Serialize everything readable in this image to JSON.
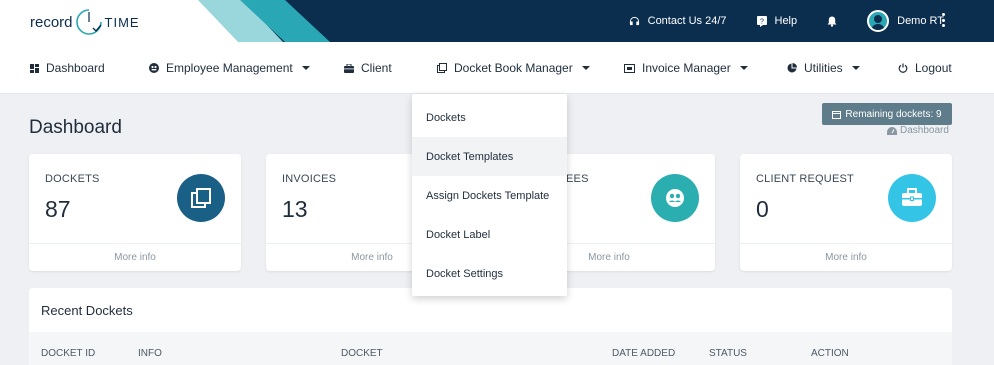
{
  "brand": {
    "logo_word": "record",
    "logo_sub": "TIME"
  },
  "topbar": {
    "contact_label": "Contact Us 24/7",
    "help_label": "Help",
    "user_name": "Demo RT"
  },
  "nav": {
    "dashboard": "Dashboard",
    "employee_management": "Employee Management",
    "client": "Client",
    "docket_book_manager": "Docket Book Manager",
    "invoice_manager": "Invoice Manager",
    "utilities": "Utilities",
    "logout": "Logout"
  },
  "page": {
    "title": "Dashboard",
    "remaining_dockets": "Remaining dockets: 9",
    "breadcrumb": "Dashboard"
  },
  "cards": [
    {
      "label": "DOCKETS",
      "value": "87",
      "more": "More info",
      "icon": "copy-icon",
      "color": "#1a5f86"
    },
    {
      "label": "INVOICES",
      "value": "13",
      "more": "More info",
      "icon": "invoice-icon",
      "color": "#2a7aa0"
    },
    {
      "label": "EES",
      "value": "",
      "more": "More info",
      "icon": "users-icon",
      "color": "#2aaeaf"
    },
    {
      "label": "CLIENT REQUEST",
      "value": "0",
      "more": "More info",
      "icon": "briefcase-icon",
      "color": "#33c4e6"
    }
  ],
  "recent": {
    "title": "Recent Dockets",
    "columns": [
      "DOCKET ID",
      "INFO",
      "DOCKET",
      "DATE ADDED",
      "STATUS",
      "ACTION"
    ]
  },
  "dropdown": {
    "items": [
      "Dockets",
      "Docket Templates",
      "Assign Dockets Template",
      "Docket Label",
      "Docket Settings"
    ],
    "hovered_index": 1
  }
}
